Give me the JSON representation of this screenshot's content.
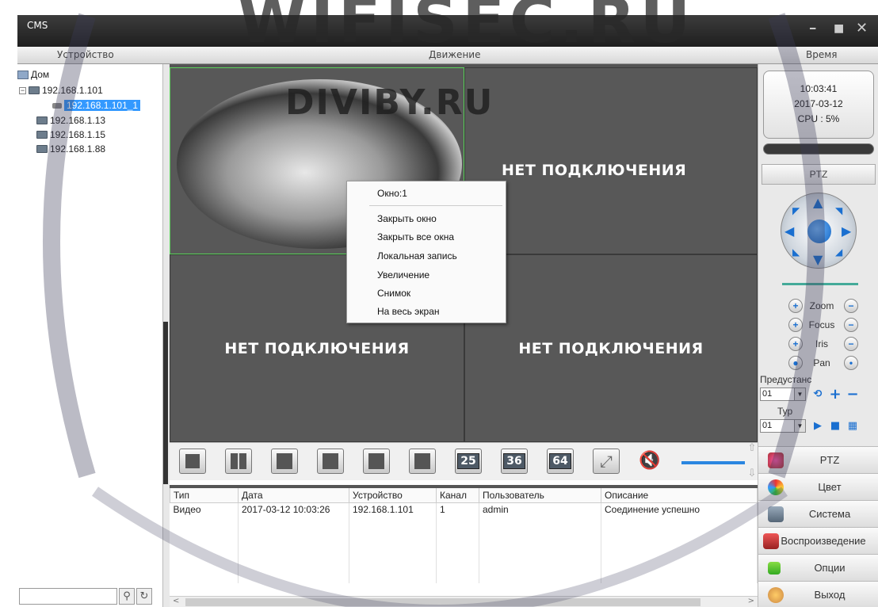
{
  "window": {
    "title": "CMS",
    "minimize": "━",
    "maximize": "■",
    "close": "✕"
  },
  "header": {
    "device": "Устройство",
    "motion": "Движение",
    "time": "Время"
  },
  "tree": {
    "root": "Дом",
    "devices": [
      {
        "label": "192.168.1.101",
        "expanded": true,
        "children": [
          "192.168.1.101_1"
        ]
      },
      {
        "label": "192.168.1.13"
      },
      {
        "label": "192.168.1.15"
      },
      {
        "label": "192.168.1.88"
      }
    ]
  },
  "video": {
    "cells": [
      {
        "id": 1,
        "state": "live",
        "text": ""
      },
      {
        "id": 2,
        "state": "empty",
        "text": "НЕТ ПОДКЛЮЧЕНИЯ"
      },
      {
        "id": 3,
        "state": "empty",
        "text": "НЕТ ПОДКЛЮЧЕНИЯ"
      },
      {
        "id": 4,
        "state": "empty",
        "text": "НЕТ ПОДКЛЮЧЕНИЯ"
      }
    ]
  },
  "context_menu": {
    "title": "Окно:1",
    "items": [
      "Закрыть окно",
      "Закрыть все окна",
      "Локальная запись",
      "Увеличение",
      "Снимок",
      "На весь экран"
    ]
  },
  "layout_buttons": [
    "1",
    "4",
    "6",
    "8",
    "9",
    "13",
    "16",
    "25",
    "36",
    "64"
  ],
  "log": {
    "columns": [
      "Тип",
      "Дата",
      "Устройство",
      "Канал",
      "Пользователь",
      "Описание"
    ],
    "rows": [
      [
        "Видео",
        "2017-03-12 10:03:26",
        "192.168.1.101",
        "1",
        "admin",
        "Соединение успешно"
      ]
    ]
  },
  "status": {
    "time": "10:03:41",
    "date": "2017-03-12",
    "cpu": "CPU : 5%"
  },
  "ptz": {
    "title": "PTZ",
    "controls": [
      "Zoom",
      "Focus",
      "Iris",
      "Pan"
    ],
    "preset_label": "Предустанс",
    "preset_value": "01",
    "tour_label": "Тур",
    "tour_value": "01"
  },
  "side_menu": [
    "PTZ",
    "Цвет",
    "Система",
    "Воспроизведение",
    "Опции",
    "Выход"
  ],
  "watermarks": {
    "main": "WIFISEC.RU",
    "secondary": "DIVIBY.RU"
  },
  "colors": {
    "accent": "#3399ff",
    "live_border": "#5bd35b",
    "ptz_blue": "#1a6fd0"
  }
}
